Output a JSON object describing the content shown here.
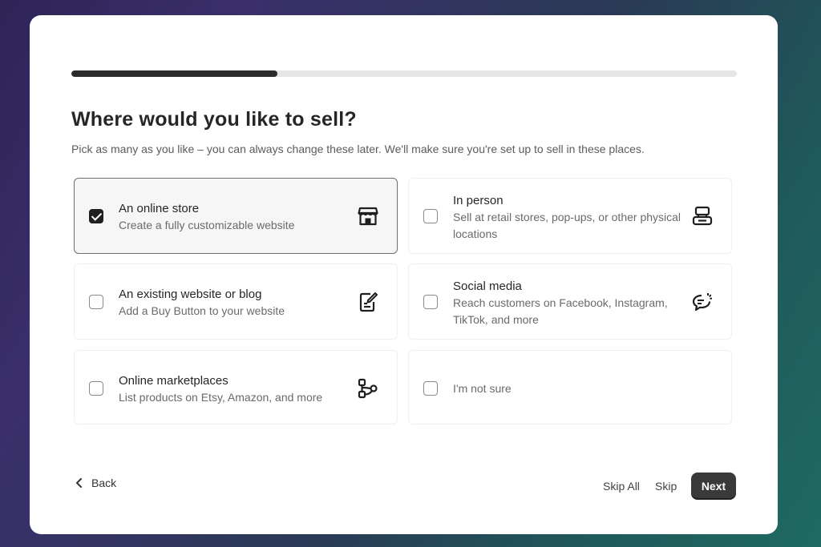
{
  "progress": {
    "value": 0.31
  },
  "header": {
    "title": "Where would you like to sell?",
    "subtitle": "Pick as many as you like – you can always change these later. We'll make sure you're set up to sell in these places."
  },
  "options": [
    {
      "title": "An online store",
      "description": "Create a fully customizable website",
      "checked": true,
      "icon": "storefront-icon"
    },
    {
      "title": "In person",
      "description": "Sell at retail stores, pop-ups, or other physical locations",
      "checked": false,
      "icon": "pos-terminal-icon"
    },
    {
      "title": "An existing website or blog",
      "description": "Add a Buy Button to your website",
      "checked": false,
      "icon": "edit-document-icon"
    },
    {
      "title": "Social media",
      "description": "Reach customers on Facebook, Instagram, TikTok, and more",
      "checked": false,
      "icon": "chat-bubble-icon"
    },
    {
      "title": "Online marketplaces",
      "description": "List products on Etsy, Amazon, and more",
      "checked": false,
      "icon": "marketplace-network-icon"
    },
    {
      "title": "I'm not sure",
      "description": "",
      "checked": false,
      "icon": ""
    }
  ],
  "footer": {
    "back_label": "Back",
    "skip_all_label": "Skip All",
    "skip_label": "Skip",
    "next_label": "Next"
  }
}
